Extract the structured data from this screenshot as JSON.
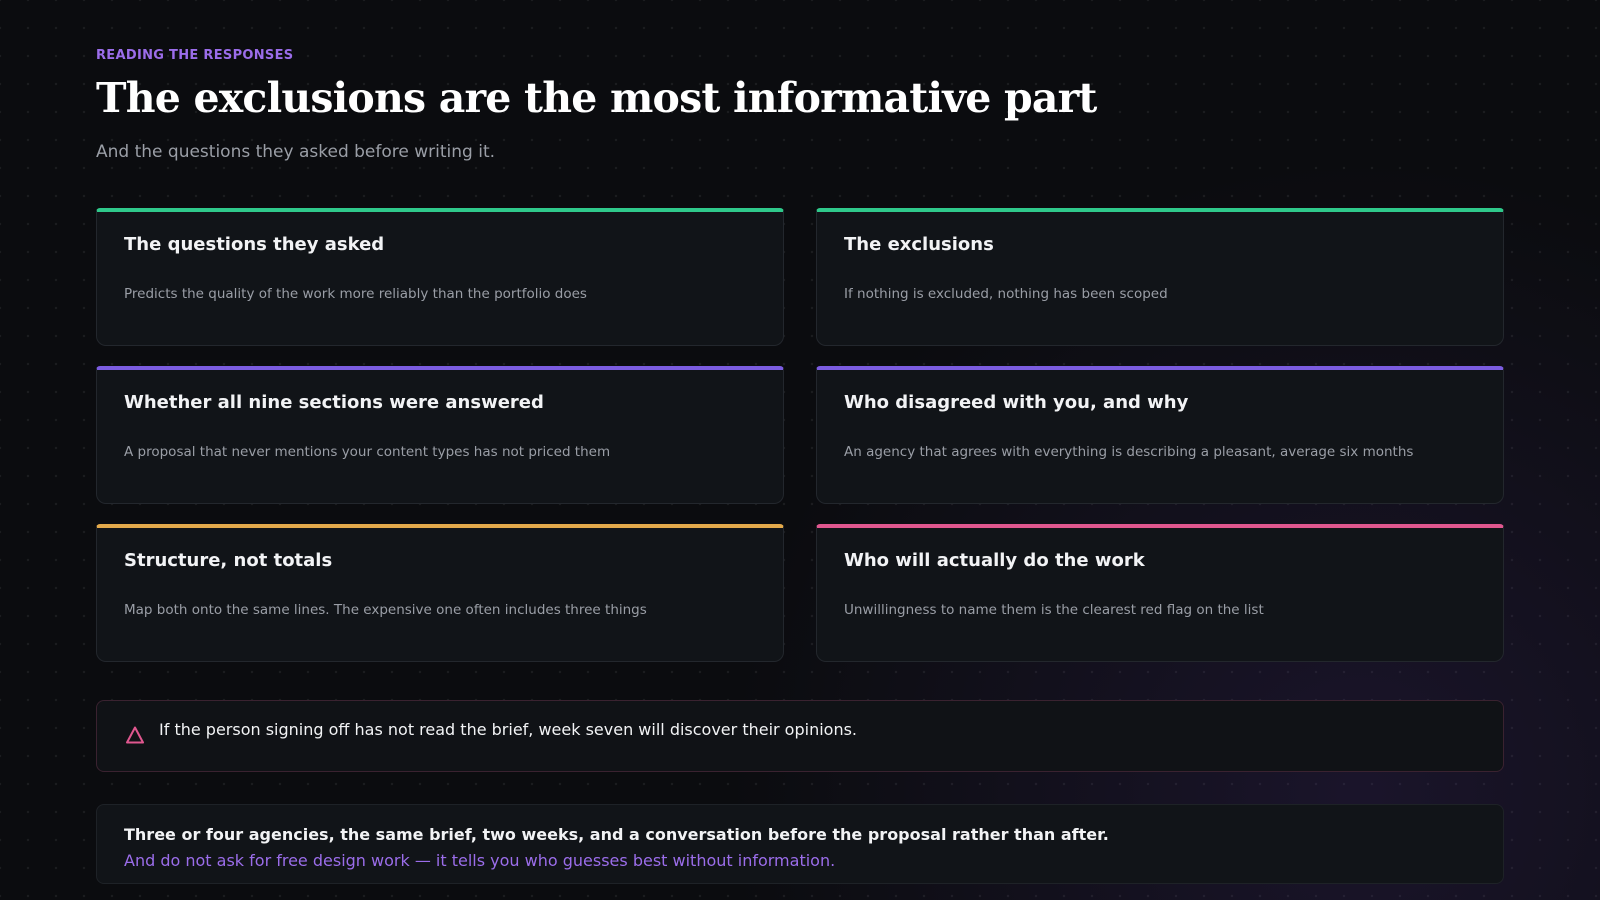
{
  "header": {
    "eyebrow": "READING THE RESPONSES",
    "title": "The exclusions are the most informative part",
    "subtitle": "And the questions they asked before writing it."
  },
  "colors": {
    "green": "#2fc98b",
    "purple": "#7b5ce0",
    "amber": "#e3a94b",
    "pink": "#e0578f",
    "accent_text": "#9b6dea"
  },
  "cards": [
    {
      "title": "The questions they asked",
      "text": "Predicts the quality of the work more reliably than the portfolio does",
      "accent": "#2fc98b"
    },
    {
      "title": "The exclusions",
      "text": "If nothing is excluded, nothing has been scoped",
      "accent": "#2fc98b"
    },
    {
      "title": "Whether all nine sections were answered",
      "text": "A proposal that never mentions your content types has not priced them",
      "accent": "#7b5ce0"
    },
    {
      "title": "Who disagreed with you, and why",
      "text": "An agency that agrees with everything is describing a pleasant, average six months",
      "accent": "#7b5ce0"
    },
    {
      "title": "Structure, not totals",
      "text": "Map both onto the same lines. The expensive one often includes three things",
      "accent": "#e3a94b"
    },
    {
      "title": "Who will actually do the work",
      "text": "Unwillingness to name them is the clearest red flag on the list",
      "accent": "#e0578f"
    }
  ],
  "warning": {
    "icon": "warning-triangle-icon",
    "text": "If the person signing off has not read the brief, week seven will discover their opinions."
  },
  "summary": {
    "line1": "Three or four agencies, the same brief, two weeks, and a conversation before the proposal rather than after.",
    "line2": "And do not ask for free design work — it tells you who guesses best without information."
  }
}
